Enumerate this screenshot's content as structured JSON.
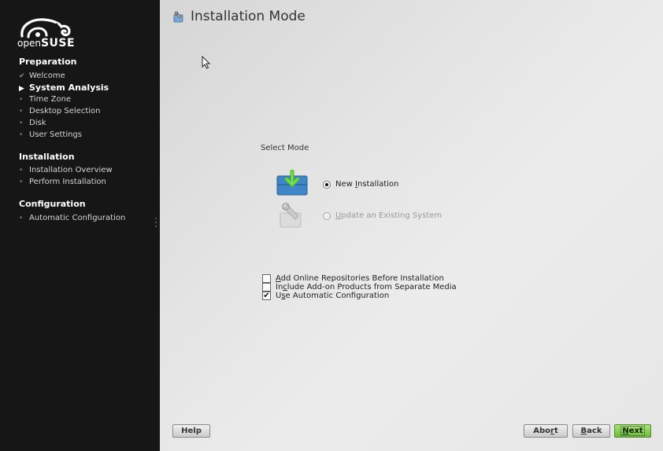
{
  "sidebar": {
    "logo_text_light": "open",
    "logo_text_bold": "SUSE",
    "sections": [
      {
        "title": "Preparation",
        "steps": [
          {
            "label": "Welcome",
            "state": "done"
          },
          {
            "label": "System Analysis",
            "state": "current"
          },
          {
            "label": "Time Zone",
            "state": "pending"
          },
          {
            "label": "Desktop Selection",
            "state": "pending"
          },
          {
            "label": "Disk",
            "state": "pending"
          },
          {
            "label": "User Settings",
            "state": "pending"
          }
        ]
      },
      {
        "title": "Installation",
        "steps": [
          {
            "label": "Installation Overview",
            "state": "pending"
          },
          {
            "label": "Perform Installation",
            "state": "pending"
          }
        ]
      },
      {
        "title": "Configuration",
        "steps": [
          {
            "label": "Automatic Configuration",
            "state": "pending"
          }
        ]
      }
    ]
  },
  "main": {
    "title": "Installation Mode",
    "select_mode_label": "Select Mode",
    "modes": [
      {
        "label_pre": "New ",
        "label_key": "I",
        "label_post": "nstallation",
        "selected": true,
        "enabled": true
      },
      {
        "label_pre": "",
        "label_key": "U",
        "label_post": "pdate an Existing System",
        "selected": false,
        "enabled": false
      }
    ],
    "options": [
      {
        "label_pre": "",
        "label_key": "A",
        "label_post": "dd Online Repositories Before Installation",
        "checked": false
      },
      {
        "label_pre": "In",
        "label_key": "c",
        "label_post": "lude Add-on Products from Separate Media",
        "checked": false
      },
      {
        "label_pre": "U",
        "label_key": "s",
        "label_post": "e Automatic Configuration",
        "checked": true
      }
    ]
  },
  "buttons": {
    "help": "Help",
    "abort_pre": "Abo",
    "abort_key": "r",
    "abort_post": "t",
    "back_pre": "",
    "back_key": "B",
    "back_post": "ack",
    "next_pre": "",
    "next_key": "N",
    "next_post": "ext"
  },
  "colors": {
    "sidebar_bg": "#161616",
    "accent_green": "#6fbb3a"
  }
}
